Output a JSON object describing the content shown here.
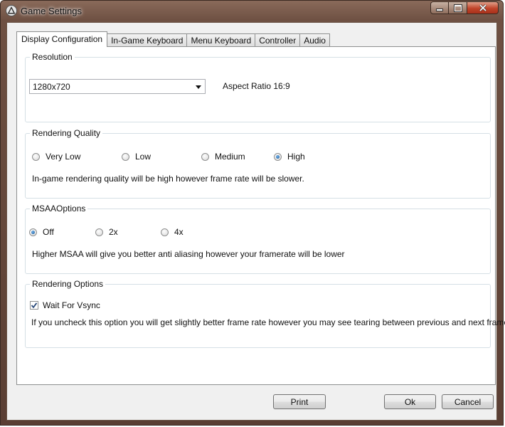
{
  "window": {
    "title": "Game Settings",
    "minimize_icon": "minimize-icon",
    "maximize_icon": "maximize-icon",
    "close_icon": "close-icon"
  },
  "tabs": [
    {
      "label": "Display Configuration",
      "active": true
    },
    {
      "label": "In-Game Keyboard",
      "active": false
    },
    {
      "label": "Menu Keyboard",
      "active": false
    },
    {
      "label": "Controller",
      "active": false
    },
    {
      "label": "Audio",
      "active": false
    }
  ],
  "resolution": {
    "label": "Resolution",
    "selected": "1280x720",
    "aspect_ratio": "Aspect Ratio 16:9"
  },
  "rendering_quality": {
    "label": "Rendering Quality",
    "options": [
      "Very Low",
      "Low",
      "Medium",
      "High"
    ],
    "selected": "High",
    "description": "In-game rendering quality will be high however frame rate will be slower."
  },
  "msaa": {
    "label": "MSAAOptions",
    "options": [
      "Off",
      "2x",
      "4x"
    ],
    "selected": "Off",
    "description": "Higher MSAA will give you better anti aliasing however your framerate will be lower"
  },
  "rendering_options": {
    "label": "Rendering Options",
    "vsync_label": "Wait For Vsync",
    "vsync_checked": true,
    "description": "If you uncheck this option you will get slightly better frame rate however you may see tearing between previous and next frames."
  },
  "buttons": {
    "print": "Print",
    "ok": "Ok",
    "cancel": "Cancel"
  }
}
